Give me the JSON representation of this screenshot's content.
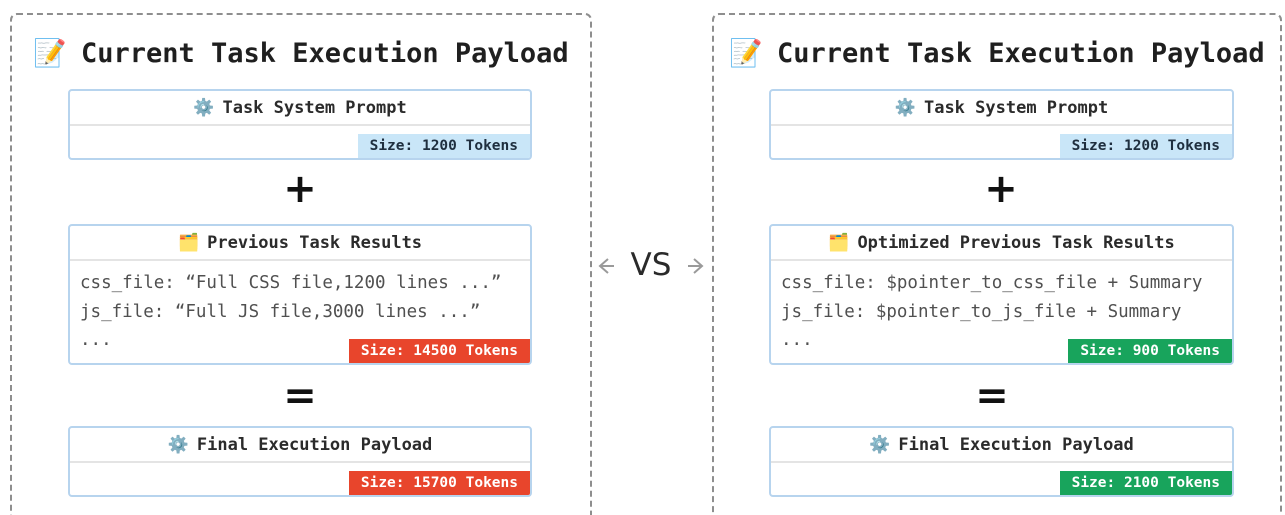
{
  "left": {
    "title": "Current Task Execution Payload",
    "title_icon": "📝",
    "system_prompt": {
      "icon": "⚙️",
      "label": "Task System Prompt",
      "badge": "Size: 1200 Tokens",
      "badge_bg": "#c9e6f8",
      "badge_color": "#1f2f3f"
    },
    "plus": "+",
    "previous": {
      "icon": "🗂️",
      "label": "Previous Task Results",
      "lines": [
        "css_file: “Full CSS file,1200 lines ...”",
        "js_file: “Full JS file,3000 lines ...”",
        "..."
      ],
      "badge": "Size: 14500 Tokens",
      "badge_bg": "#e8452c",
      "badge_color": "#ffffff"
    },
    "equals": "=",
    "final": {
      "icon": "⚙️",
      "label": "Final Execution Payload",
      "badge": "Size: 15700 Tokens",
      "badge_bg": "#e8452c",
      "badge_color": "#ffffff"
    }
  },
  "vs": "VS",
  "right": {
    "title": "Current Task Execution Payload",
    "title_icon": "📝",
    "system_prompt": {
      "icon": "⚙️",
      "label": "Task System Prompt",
      "badge": "Size: 1200 Tokens",
      "badge_bg": "#c9e6f8",
      "badge_color": "#1f2f3f"
    },
    "plus": "+",
    "previous": {
      "icon": "🗂️",
      "label": "Optimized Previous Task Results",
      "lines": [
        "css_file: $pointer_to_css_file + Summary",
        "js_file: $pointer_to_js_file + Summary",
        "..."
      ],
      "badge": "Size: 900 Tokens",
      "badge_bg": "#18a45c",
      "badge_color": "#ffffff"
    },
    "equals": "=",
    "final": {
      "icon": "⚙️",
      "label": "Final Execution Payload",
      "badge": "Size: 2100 Tokens",
      "badge_bg": "#18a45c",
      "badge_color": "#ffffff"
    }
  }
}
